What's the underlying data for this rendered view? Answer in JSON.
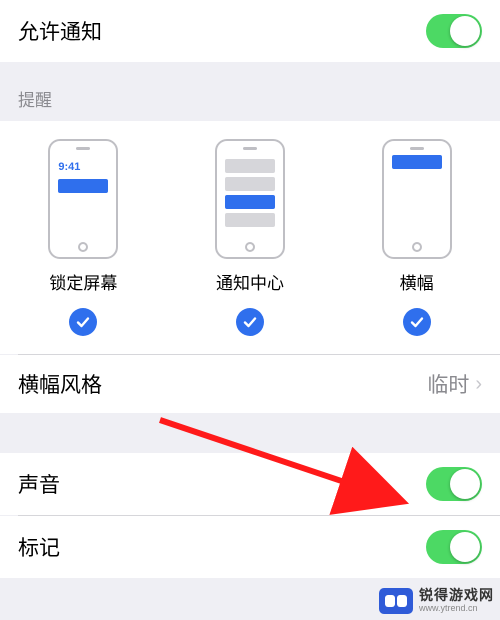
{
  "allow_notifications": {
    "label": "允许通知",
    "enabled": true
  },
  "alerts": {
    "header": "提醒",
    "options": [
      {
        "key": "lock",
        "label": "锁定屏幕",
        "checked": true,
        "time": "9:41"
      },
      {
        "key": "center",
        "label": "通知中心",
        "checked": true
      },
      {
        "key": "banner",
        "label": "横幅",
        "checked": true
      }
    ]
  },
  "banner_style": {
    "label": "横幅风格",
    "value": "临时"
  },
  "sounds": {
    "label": "声音",
    "enabled": true
  },
  "badges": {
    "label": "标记",
    "enabled": true
  },
  "watermark": {
    "cn": "锐得游戏网",
    "en": "www.ytrend.cn"
  }
}
